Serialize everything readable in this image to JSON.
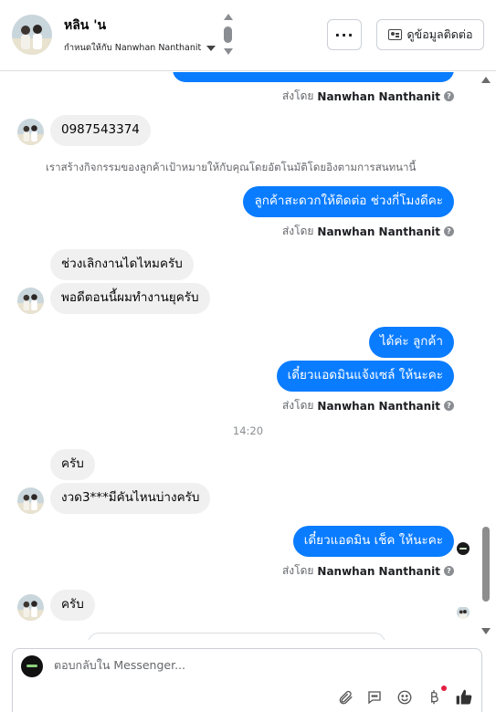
{
  "header": {
    "contact_name": "หลิน 'น",
    "assigned_label": "กำหนดให้กับ Nanwhan Nanthanit",
    "more_label": "···",
    "contact_info_label": "ดูข้อมูลติดต่อ"
  },
  "conversation": {
    "sent_by_prefix": "ส่งโดย",
    "sent_by_agent": "Nanwhan Nanthanit",
    "phone_message": "0987543374",
    "system_note": "เราสร้างกิจกรรมของลูกค้าเป้าหมายให้กับคุณโดยอัตโนมัติโดยอิงตามการสนทนานี้",
    "out_message_1": "ลูกค้าสะดวกให้ติดต่อ ช่วงกี่โมงดีคะ",
    "in_message_1": "ช่วงเลิกงานไดไหมครับ",
    "in_message_2": "พอดีตอนนี้ผมทำงานยุครับ",
    "out_message_2": "ได้ค่ะ  ลูกค้า",
    "out_message_3": "เดี๋ยวแอดมินแจ้งเซล์ ให้นะคะ",
    "timestamp": "14:20",
    "in_message_3": "ครับ",
    "in_message_4": "งวด3***มีคันไหนบ่างครับ",
    "out_message_4": "เดี๋ยวแอดมิน เช็ค ให้นะคะ",
    "in_message_5": "ครับ"
  },
  "composer": {
    "placeholder": "ตอบกลับใน Messenger..."
  },
  "colors": {
    "outgoing_bubble": "#0a7cff",
    "incoming_bubble": "#f0f0f0",
    "notification_dot": "#e41e3f"
  },
  "icons": {
    "attach": "paperclip-icon",
    "saved_replies": "chat-bubble-icon",
    "emoji": "smiley-icon",
    "payment": "baht-icon",
    "like": "thumbs-up-icon"
  }
}
